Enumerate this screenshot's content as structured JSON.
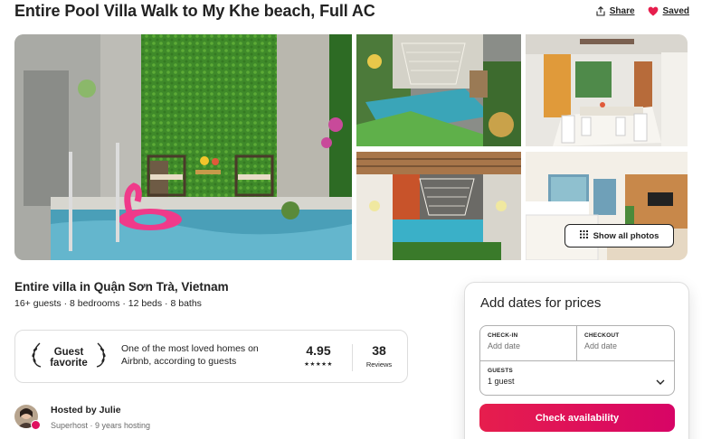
{
  "header": {
    "title": "Entire Pool Villa Walk to My Khe beach, Full AC",
    "share_label": "Share",
    "saved_label": "Saved"
  },
  "gallery": {
    "show_all_label": "Show all photos"
  },
  "listing": {
    "type": "Entire villa in Quận Sơn Trà, Vietnam",
    "details": "16+ guests · 8 bedrooms · 12 beds · 8 baths"
  },
  "favorite": {
    "badge_line1": "Guest",
    "badge_line2": "favorite",
    "description": "One of the most loved homes on Airbnb, according to guests",
    "rating": "4.95",
    "stars": "★★★★★",
    "reviews_count": "38",
    "reviews_label": "Reviews"
  },
  "host": {
    "name": "Hosted by Julie",
    "subtitle": "Superhost · 9 years hosting"
  },
  "booking": {
    "title": "Add dates for prices",
    "checkin_label": "CHECK-IN",
    "checkin_placeholder": "Add date",
    "checkout_label": "CHECKOUT",
    "checkout_placeholder": "Add date",
    "guests_label": "GUESTS",
    "guests_value": "1 guest",
    "button_label": "Check availability"
  },
  "colors": {
    "brand": "#e61e4d",
    "saved_heart": "#e61e4d"
  }
}
